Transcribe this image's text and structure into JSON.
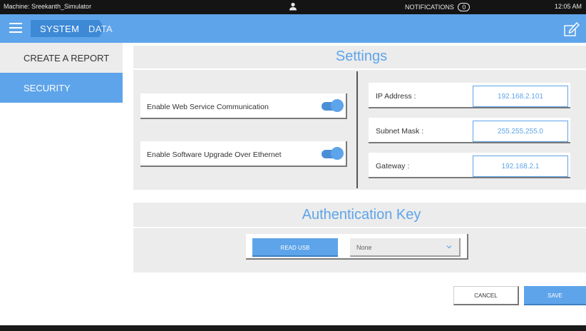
{
  "statusbar": {
    "machine": "Machine: Sreekanth_Simulator",
    "user_icon": "user-icon",
    "notifications_label": "NOTIFICATIONS",
    "notifications_count": "0",
    "time": "12:05 AM"
  },
  "nav": {
    "menu_icon": "hamburger-icon",
    "tabs": [
      {
        "label": "SYSTEM",
        "active": true
      },
      {
        "label": "DATA",
        "active": false
      }
    ],
    "edit_icon": "edit-icon"
  },
  "sidebar": {
    "items": [
      {
        "label": "CREATE A REPORT",
        "active": false
      },
      {
        "label": "SECURITY",
        "active": true
      }
    ]
  },
  "settings": {
    "title": "Settings",
    "toggles": [
      {
        "label": "Enable Web Service Communication",
        "on": true
      },
      {
        "label": "Enable Software Upgrade Over Ethernet",
        "on": true
      }
    ],
    "network": [
      {
        "label": "IP Address :",
        "value": "192.168.2.101"
      },
      {
        "label": "Subnet Mask :",
        "value": "255.255.255.0"
      },
      {
        "label": "Gateway :",
        "value": "192.168.2.1"
      }
    ]
  },
  "auth": {
    "title": "Authentication Key",
    "read_usb_label": "READ USB",
    "select_value": "None"
  },
  "actions": {
    "cancel_label": "CANCEL",
    "save_label": "SAVE"
  },
  "colors": {
    "accent": "#5ea4ea",
    "panel": "#ececec",
    "statusbar": "#141414"
  }
}
